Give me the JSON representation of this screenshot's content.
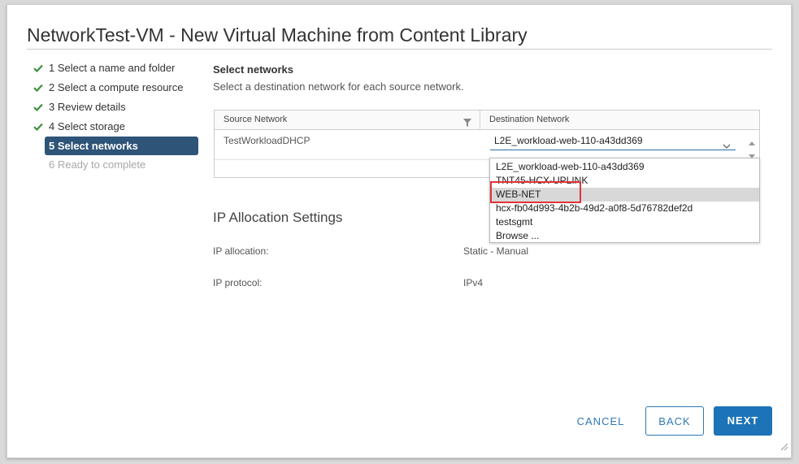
{
  "dialog": {
    "title": "NetworkTest-VM - New Virtual Machine from Content Library"
  },
  "steps": [
    {
      "label": "1 Select a name and folder",
      "state": "done"
    },
    {
      "label": "2 Select a compute resource",
      "state": "done"
    },
    {
      "label": "3 Review details",
      "state": "done"
    },
    {
      "label": "4 Select storage",
      "state": "done"
    },
    {
      "label": "5 Select networks",
      "state": "active"
    },
    {
      "label": "6 Ready to complete",
      "state": "disabled"
    }
  ],
  "networks": {
    "title": "Select networks",
    "description": "Select a destination network for each source network.",
    "columns": {
      "source": "Source Network",
      "destination": "Destination Network"
    },
    "row": {
      "source": "TestWorkloadDHCP",
      "destination": "L2E_workload-web-110-a43dd369"
    },
    "dropdown_options": [
      "L2E_workload-web-110-a43dd369",
      "TNT45-HCX-UPLINK",
      "WEB-NET",
      "hcx-fb04d993-4b2b-49d2-a0f8-5d76782def2d",
      "testsgmt",
      "Browse ..."
    ],
    "highlighted_option": "WEB-NET"
  },
  "ip_settings": {
    "title": "IP Allocation Settings",
    "allocation_label": "IP allocation:",
    "allocation_value": "Static - Manual",
    "protocol_label": "IP protocol:",
    "protocol_value": "IPv4"
  },
  "buttons": {
    "cancel": "CANCEL",
    "back": "BACK",
    "next": "NEXT"
  },
  "colors": {
    "accent": "#1d73b8",
    "active_step": "#2e5478",
    "check": "#3d8f3d",
    "highlight": "#e03535"
  }
}
